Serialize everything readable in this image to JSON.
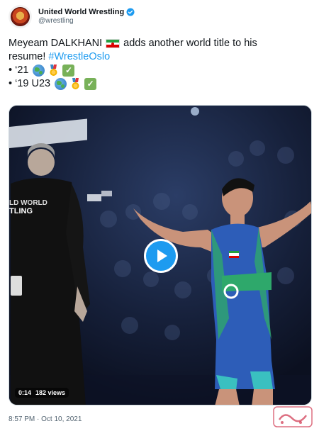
{
  "author": {
    "display_name": "United World Wrestling",
    "handle": "@wrestling",
    "avatar_icon": "uww-logo-icon",
    "verified_icon": "verified-badge-icon",
    "verified_color": "#1d9bf0"
  },
  "tweet": {
    "line1_text": "Meyeam DALKHANI",
    "line1_after_flag": "adds another world title to his",
    "line2_text": "resume!",
    "hashtag": "#WrestleOslo",
    "bullet1": "• ‘21",
    "bullet2": "• ‘19 U23",
    "flag_icon": "iran-flag-icon",
    "emoji_icons": [
      "globe-icon",
      "medal-icon",
      "check-mark-icon"
    ]
  },
  "video": {
    "duration": "0:14",
    "views": "182 views",
    "play_icon": "play-icon"
  },
  "meta": {
    "timestamp": "8:57 PM · Oct 10, 2021"
  },
  "colors": {
    "link": "#1d9bf0",
    "secondary_text": "#536471",
    "primary_text": "#0f1419"
  }
}
